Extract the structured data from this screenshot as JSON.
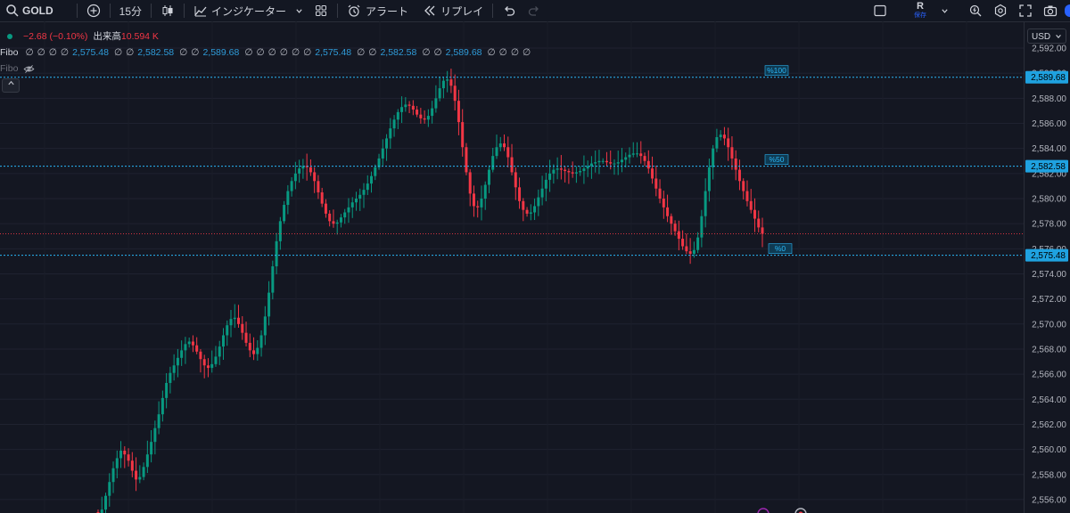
{
  "toolbar": {
    "symbol": "GOLD",
    "interval": "15分",
    "indicators_label": "インジケーター",
    "alert_label": "アラート",
    "replay_label": "リプレイ",
    "account_initial": "R",
    "save_label": "保存"
  },
  "legend": {
    "change": "−2.68 (−0.10%)",
    "volume_label": "出来高",
    "volume_value": "10.594 K",
    "fibo_name": "Fibo",
    "fibo_values": [
      "2,575.48",
      "2,582.58",
      "2,589.68",
      "2,575.48",
      "2,582.58",
      "2,589.68"
    ],
    "fibo_hidden_name": "Fibo"
  },
  "currency": "USD",
  "chart_data": {
    "type": "candlestick",
    "symbol": "GOLD",
    "interval": "15分",
    "ylim": [
      2555,
      2592.5
    ],
    "y_ticks": [
      "2,592.00",
      "2,590.00",
      "2,588.00",
      "2,586.00",
      "2,584.00",
      "2,582.00",
      "2,580.00",
      "2,578.00",
      "2,576.00",
      "2,574.00",
      "2,572.00",
      "2,570.00",
      "2,568.00",
      "2,566.00",
      "2,564.00",
      "2,562.00",
      "2,560.00",
      "2,558.00",
      "2,556.00"
    ],
    "fib_levels": [
      {
        "label": "%100",
        "price": 2589.68,
        "price_label": "2,589.68"
      },
      {
        "label": "%50",
        "price": 2582.58,
        "price_label": "2,582.58"
      },
      {
        "label": "%0",
        "price": 2575.48,
        "price_label": "2,575.48"
      }
    ],
    "last_price": 2577.2,
    "colors": {
      "up": "#089981",
      "down": "#f23645",
      "fib": "#29b6f6",
      "background": "#141722"
    },
    "closes": [
      2554.6,
      2555.2,
      2556.3,
      2557.4,
      2558.5,
      2559.3,
      2559.9,
      2559.6,
      2559.1,
      2558.3,
      2557.6,
      2557.8,
      2558.6,
      2559.6,
      2560.6,
      2561.7,
      2562.8,
      2564.1,
      2565.3,
      2566.1,
      2566.7,
      2567.3,
      2567.9,
      2568.4,
      2568.6,
      2568.3,
      2567.8,
      2567.2,
      2566.7,
      2566.5,
      2566.8,
      2567.4,
      2568.2,
      2569.1,
      2569.9,
      2570.4,
      2570.5,
      2570.0,
      2569.3,
      2568.5,
      2567.9,
      2567.6,
      2568.1,
      2569.1,
      2570.6,
      2572.5,
      2574.6,
      2576.6,
      2578.2,
      2579.5,
      2580.6,
      2581.4,
      2582.0,
      2582.4,
      2582.6,
      2582.5,
      2582.1,
      2581.4,
      2580.5,
      2579.6,
      2578.8,
      2578.2,
      2578.0,
      2578.1,
      2578.5,
      2578.9,
      2579.3,
      2579.7,
      2580.0,
      2580.3,
      2580.7,
      2581.2,
      2581.8,
      2582.5,
      2583.2,
      2584.0,
      2584.8,
      2585.6,
      2586.3,
      2586.9,
      2587.3,
      2587.5,
      2587.4,
      2587.1,
      2586.7,
      2586.4,
      2586.3,
      2586.6,
      2587.2,
      2588.0,
      2588.8,
      2589.4,
      2589.5,
      2589.0,
      2587.8,
      2586.1,
      2584.1,
      2582.1,
      2580.4,
      2579.4,
      2579.3,
      2580.0,
      2581.1,
      2582.3,
      2583.4,
      2584.1,
      2584.4,
      2584.1,
      2583.3,
      2582.1,
      2580.9,
      2579.8,
      2579.1,
      2578.8,
      2578.9,
      2579.4,
      2580.1,
      2580.8,
      2581.5,
      2582.0,
      2582.3,
      2582.4,
      2582.3,
      2582.2,
      2582.1,
      2582.0,
      2582.1,
      2582.2,
      2582.4,
      2582.6,
      2582.8,
      2582.9,
      2583.0,
      2583.0,
      2582.9,
      2582.8,
      2582.8,
      2582.9,
      2583.1,
      2583.3,
      2583.5,
      2583.6,
      2583.6,
      2583.4,
      2583.0,
      2582.4,
      2581.6,
      2580.8,
      2580.0,
      2579.3,
      2578.6,
      2578.0,
      2577.4,
      2576.8,
      2576.2,
      2575.8,
      2575.6,
      2575.9,
      2576.9,
      2578.6,
      2580.6,
      2582.5,
      2584.0,
      2584.9,
      2585.1,
      2584.8,
      2584.1,
      2583.2,
      2582.3,
      2581.4,
      2580.6,
      2579.8,
      2579.1,
      2578.4,
      2577.7,
      2577.2
    ]
  }
}
